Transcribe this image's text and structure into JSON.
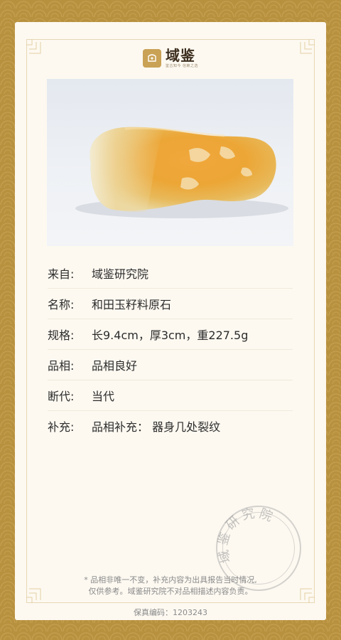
{
  "brand": {
    "name": "域鉴",
    "tagline": "鉴古知今 信赖之选"
  },
  "rows": [
    {
      "label": "来自:",
      "value": "域鉴研究院"
    },
    {
      "label": "名称:",
      "value": "和田玉籽料原石"
    },
    {
      "label": "规格:",
      "value": "长9.4cm，厚3cm，重227.5g"
    },
    {
      "label": "品相:",
      "value": "品相良好"
    },
    {
      "label": "断代:",
      "value": "当代"
    },
    {
      "label": "补充:",
      "value": "品相补充： 器身几处裂纹"
    }
  ],
  "seal_text": "域鉴研究院",
  "note_line1": "* 品相非唯一不变，补充内容为出具报告当时情况,",
  "note_line2": "仅供参考。域鉴研究院不对品相描述内容负责。",
  "serial": "保真编码：1203243",
  "colors": {
    "border_gold": "#b8913f",
    "card_bg": "#fdf9f1",
    "text": "#2c2c2c",
    "muted": "#8a8a8a"
  }
}
